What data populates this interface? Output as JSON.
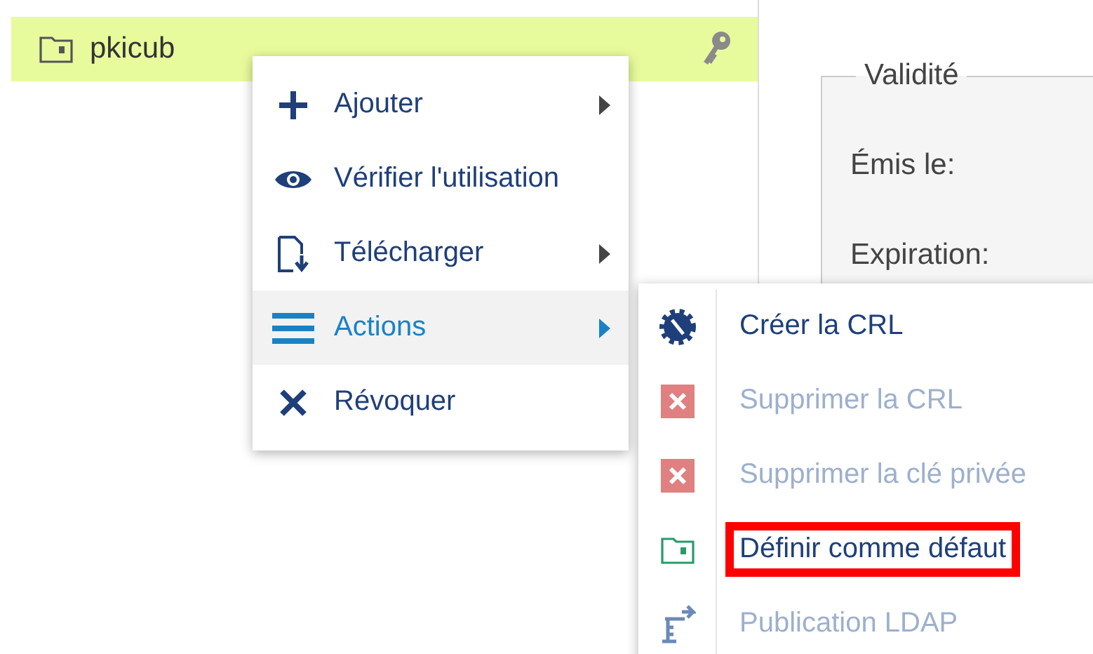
{
  "tree_item": {
    "label": "pkicub",
    "selected": true
  },
  "context_menu": [
    {
      "label": "Ajouter",
      "has_submenu": true,
      "selected": false
    },
    {
      "label": "Vérifier l'utilisation",
      "has_submenu": false,
      "selected": false
    },
    {
      "label": "Télécharger",
      "has_submenu": true,
      "selected": false
    },
    {
      "label": "Actions",
      "has_submenu": true,
      "selected": true
    },
    {
      "label": "Révoquer",
      "has_submenu": false,
      "selected": false
    }
  ],
  "submenu": [
    {
      "label": "Créer la CRL",
      "disabled": false,
      "highlighted": false
    },
    {
      "label": "Supprimer la CRL",
      "disabled": true,
      "highlighted": false
    },
    {
      "label": "Supprimer la clé privée",
      "disabled": true,
      "highlighted": false
    },
    {
      "label": "Définir comme défaut",
      "disabled": false,
      "highlighted": true
    },
    {
      "label": "Publication LDAP",
      "disabled": true,
      "highlighted": false
    }
  ],
  "validity": {
    "legend": "Validité",
    "fields": [
      "Émis le:",
      "Expiration:"
    ]
  }
}
